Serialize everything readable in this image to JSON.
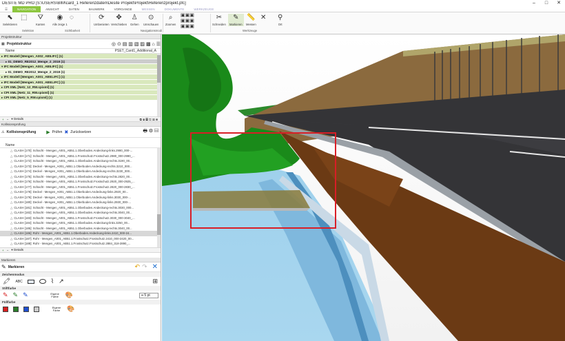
{
  "window": {
    "title": "DESITE MD PRO [S:\\USERS\\BIM\\card_1 Referenzdaten\\Desite Projekt\\Projekt\\Referenzprojekt.pfc]"
  },
  "ribbon_tabs": [
    "NAVIGATION",
    "ANSICHT",
    "DATEN",
    "BAUWERK",
    "VORGANGE",
    "MESSEN",
    "DOKUMENTE",
    "WERKZEUGE"
  ],
  "ribbon": {
    "selektieren": "Selektieren",
    "kanten": "Kanten",
    "alle_zeige": "Alle zeige 1",
    "umbenieten": "Umbenieten",
    "verschieben": "Verschieben",
    "gehen": "Gehen",
    "umschauen": "Umschauen",
    "zoomen": "Zoomen",
    "schneiden": "Schneiden",
    "markieren": "Markieren",
    "messen": "Messen",
    "ort": "Ort",
    "grp_selektion": "Selektion",
    "grp_sichtbarkeit": "Sichtbarkeit",
    "grp_navigation": "Navigationsmodi",
    "grp_werkzeuge": "Werkzeuge"
  },
  "project": {
    "panel_title": "Projektstruktur",
    "toolbar_label": "Projektstruktur",
    "col_name": "Name",
    "col_pset": "PSET_Card1_Additional_A",
    "rows": [
      "IFC Modell [Mengen_A002_AB5.IFC] (1)",
      "01_DEMO_RE2012_Menge_2_2019 (1)",
      "IFC Modell [Mengen_A001_AB5.IFC] (1)",
      "01_DEMO_RE2012_Menge_2_2019 (1)",
      "IFC Modell [Mengen_A001_AB51.IFC] (1)",
      "IFC Modell [Mengen_A001_AB51.IFC] (1)",
      "CPI XML [Netz_12_RW.cpixml] (1)",
      "CPI XML [Netz_11_RW.cpixml] (1)",
      "CPI XML [Netz_5_RW.cpixml] (1)"
    ],
    "details": "Details"
  },
  "clash": {
    "panel_title": "Kollisionsprüfung",
    "toolbar_label": "Kollisionsprüfung",
    "pruefen": "Prüfen",
    "zuruecksetzen": "Zurücksetzen",
    "col_name": "Name",
    "rows": [
      "CLASH [170]: Schacht - Mengen_A001_AB51.1.Oberboden.Andeckung-links.2980_000-...",
      "CLASH [171]: Schacht - Mengen_A001_AB51.1.Frostschutz.Frostschutz.2980_000-2990_...",
      "CLASH [172]: Schacht - Mengen_A001_AB51.1.Oberboden.Andeckung-rechts.3190_00...",
      "CLASH [173]: Deckel - Mengen_A001_AB51.1.Oberboden.Andeckung-rechts.3210_000...",
      "CLASH [174]: Deckel - Mengen_A001_AB51.1.Oberboden.Andeckung-rechts.3230_000...",
      "CLASH [175]: Schacht - Mengen_A001_AB51.1.Oberboden.Andeckung-rechts.2820_00...",
      "CLASH [176]: Schacht - Mengen_A001_AB51.1.Frostschutz.Frostschutz.2920_000-2925_...",
      "CLASH [177]: Schacht - Mengen_A001_AB51.1.Frostschutz.Frostschutz.2820_000-2830_...",
      "CLASH [178]: Deckel - Mengen_A001_AB51.1.Oberboden.Andeckung-links.2920_00...",
      "CLASH [179]: Deckel - Mengen_A001_AB51.1.Oberboden.Andeckung-links.3030_000-...",
      "CLASH [180]: Deckel - Mengen_A001_AB51.1.Oberboden.Andeckung-links.2930_000-...",
      "CLASH [181]: Schacht - Mengen_A001_AB51.1.Oberboden.Andeckung-rechts.3030_000...",
      "CLASH [182]: Schacht - Mengen_A001_AB51.1.Oberboden.Andeckung-rechts.3040_00...",
      "CLASH [183]: Schacht - Mengen_A001_AB51.1.Frostschutz.Frostschutz.3030_000-3040_...",
      "CLASH [184]: Schacht - Mengen_A001_AB51.1.Oberboden.Andeckung-links.3250_00...",
      "CLASH [185]: Schacht - Mengen_A001_AB51.1.Oberboden.Andeckung-rechts.3040_00...",
      "CLASH [186]: Rohr - Mengen_A001_AB51.1.Oberboden.Andeckung-links.2410_000-24...",
      "CLASH [187]: Rohr - Mengen_A001_AB51.1.Frostschutz.Frostschutz.2410_000-2420_00...",
      "CLASH [188]: Rohr - Mengen_A001_AB51.1.Frostschutz.Frostschutz.2884_318-2890_..."
    ],
    "selected_index": 16,
    "details": "Details"
  },
  "marker": {
    "panel_title": "Markieren",
    "toolbar_label": "Markieren",
    "section_draw": "Zeichenmodus",
    "abc": "ABC",
    "section_stift": "Stiftfarbe",
    "section_fuell": "Füllfarbe",
    "eigene_farbe": "Eigene Farbe",
    "pt_value": "5 pt",
    "stift_colors": [
      "#d62020",
      "#2b7d2b",
      "#1f4fcf"
    ],
    "fuell_colors": [
      "#d62020",
      "#2b7d2b",
      "#1f4fcf"
    ]
  },
  "colors": {
    "accent": "#8dc63f",
    "highlight": "#d91e26",
    "green_tree": "#1a8a1a"
  }
}
